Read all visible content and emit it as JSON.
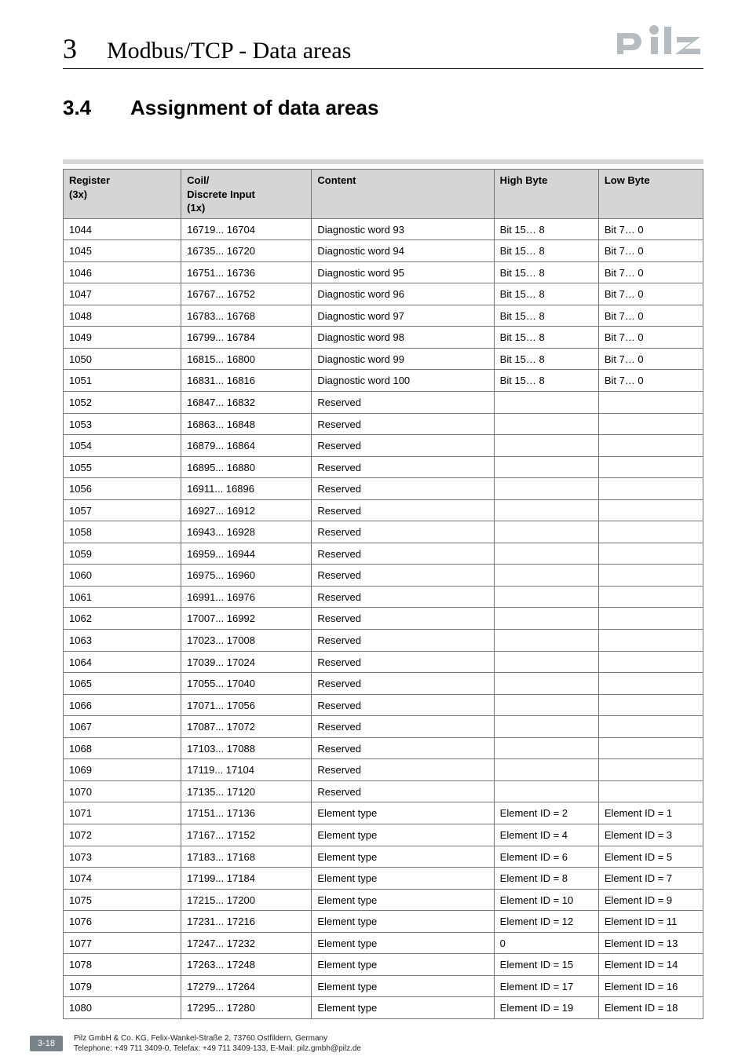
{
  "header": {
    "chapter_number": "3",
    "chapter_title": "Modbus/TCP - Data areas"
  },
  "section": {
    "number": "3.4",
    "title": "Assignment of data areas"
  },
  "table": {
    "headers": {
      "c1a": "Register",
      "c1b": "(3x)",
      "c2a": "Coil/",
      "c2b": "Discrete Input",
      "c2c": "(1x)",
      "c3": "Content",
      "c4": "High Byte",
      "c5": "Low Byte"
    },
    "rows": [
      {
        "r": "1044",
        "c": "16719... 16704",
        "t": "Diagnostic word 93",
        "h": "Bit 15… 8",
        "l": "Bit 7… 0"
      },
      {
        "r": "1045",
        "c": "16735... 16720",
        "t": "Diagnostic word 94",
        "h": "Bit 15… 8",
        "l": "Bit 7… 0"
      },
      {
        "r": "1046",
        "c": "16751... 16736",
        "t": "Diagnostic word 95",
        "h": "Bit 15… 8",
        "l": "Bit 7… 0"
      },
      {
        "r": "1047",
        "c": "16767... 16752",
        "t": "Diagnostic word 96",
        "h": "Bit 15… 8",
        "l": "Bit 7… 0"
      },
      {
        "r": "1048",
        "c": "16783... 16768",
        "t": "Diagnostic word 97",
        "h": "Bit 15… 8",
        "l": "Bit 7… 0"
      },
      {
        "r": "1049",
        "c": "16799... 16784",
        "t": "Diagnostic word 98",
        "h": "Bit 15… 8",
        "l": "Bit 7… 0"
      },
      {
        "r": "1050",
        "c": "16815... 16800",
        "t": "Diagnostic word 99",
        "h": "Bit 15… 8",
        "l": "Bit 7… 0"
      },
      {
        "r": "1051",
        "c": "16831... 16816",
        "t": "Diagnostic word 100",
        "h": "Bit 15… 8",
        "l": "Bit 7… 0"
      },
      {
        "r": "1052",
        "c": "16847... 16832",
        "t": "Reserved",
        "h": "",
        "l": ""
      },
      {
        "r": "1053",
        "c": "16863... 16848",
        "t": "Reserved",
        "h": "",
        "l": ""
      },
      {
        "r": "1054",
        "c": "16879... 16864",
        "t": "Reserved",
        "h": "",
        "l": ""
      },
      {
        "r": "1055",
        "c": "16895... 16880",
        "t": "Reserved",
        "h": "",
        "l": ""
      },
      {
        "r": "1056",
        "c": "16911... 16896",
        "t": "Reserved",
        "h": "",
        "l": ""
      },
      {
        "r": "1057",
        "c": "16927... 16912",
        "t": "Reserved",
        "h": "",
        "l": ""
      },
      {
        "r": "1058",
        "c": "16943... 16928",
        "t": "Reserved",
        "h": "",
        "l": ""
      },
      {
        "r": "1059",
        "c": "16959... 16944",
        "t": "Reserved",
        "h": "",
        "l": ""
      },
      {
        "r": "1060",
        "c": "16975... 16960",
        "t": "Reserved",
        "h": "",
        "l": ""
      },
      {
        "r": "1061",
        "c": "16991... 16976",
        "t": "Reserved",
        "h": "",
        "l": ""
      },
      {
        "r": "1062",
        "c": "17007... 16992",
        "t": "Reserved",
        "h": "",
        "l": ""
      },
      {
        "r": "1063",
        "c": "17023... 17008",
        "t": "Reserved",
        "h": "",
        "l": ""
      },
      {
        "r": "1064",
        "c": "17039... 17024",
        "t": "Reserved",
        "h": "",
        "l": ""
      },
      {
        "r": "1065",
        "c": "17055... 17040",
        "t": "Reserved",
        "h": "",
        "l": ""
      },
      {
        "r": "1066",
        "c": "17071... 17056",
        "t": "Reserved",
        "h": "",
        "l": ""
      },
      {
        "r": "1067",
        "c": "17087... 17072",
        "t": "Reserved",
        "h": "",
        "l": ""
      },
      {
        "r": "1068",
        "c": "17103... 17088",
        "t": "Reserved",
        "h": "",
        "l": ""
      },
      {
        "r": "1069",
        "c": "17119... 17104",
        "t": "Reserved",
        "h": "",
        "l": ""
      },
      {
        "r": "1070",
        "c": "17135... 17120",
        "t": "Reserved",
        "h": "",
        "l": ""
      },
      {
        "r": "1071",
        "c": "17151... 17136",
        "t": "Element type",
        "h": "Element ID = 2",
        "l": "Element ID = 1"
      },
      {
        "r": "1072",
        "c": "17167... 17152",
        "t": "Element type",
        "h": "Element ID = 4",
        "l": "Element ID = 3"
      },
      {
        "r": "1073",
        "c": "17183... 17168",
        "t": "Element type",
        "h": "Element ID = 6",
        "l": "Element ID = 5"
      },
      {
        "r": "1074",
        "c": "17199... 17184",
        "t": "Element type",
        "h": "Element ID = 8",
        "l": "Element ID = 7"
      },
      {
        "r": "1075",
        "c": "17215... 17200",
        "t": "Element type",
        "h": "Element ID = 10",
        "l": "Element ID = 9"
      },
      {
        "r": "1076",
        "c": "17231... 17216",
        "t": "Element type",
        "h": "Element ID = 12",
        "l": "Element ID = 11"
      },
      {
        "r": "1077",
        "c": "17247... 17232",
        "t": "Element type",
        "h": "0",
        "l": "Element ID = 13"
      },
      {
        "r": "1078",
        "c": "17263... 17248",
        "t": "Element type",
        "h": "Element ID = 15",
        "l": "Element ID = 14"
      },
      {
        "r": "1079",
        "c": "17279... 17264",
        "t": "Element type",
        "h": "Element ID = 17",
        "l": "Element ID = 16"
      },
      {
        "r": "1080",
        "c": "17295... 17280",
        "t": "Element type",
        "h": "Element ID = 19",
        "l": "Element ID = 18"
      }
    ]
  },
  "footer": {
    "page": "3-18",
    "line1": "Pilz GmbH & Co. KG, Felix-Wankel-Straße 2, 73760 Ostfildern, Germany",
    "line2": "Telephone: +49 711 3409-0, Telefax: +49 711 3409-133, E-Mail: pilz.gmbh@pilz.de"
  }
}
